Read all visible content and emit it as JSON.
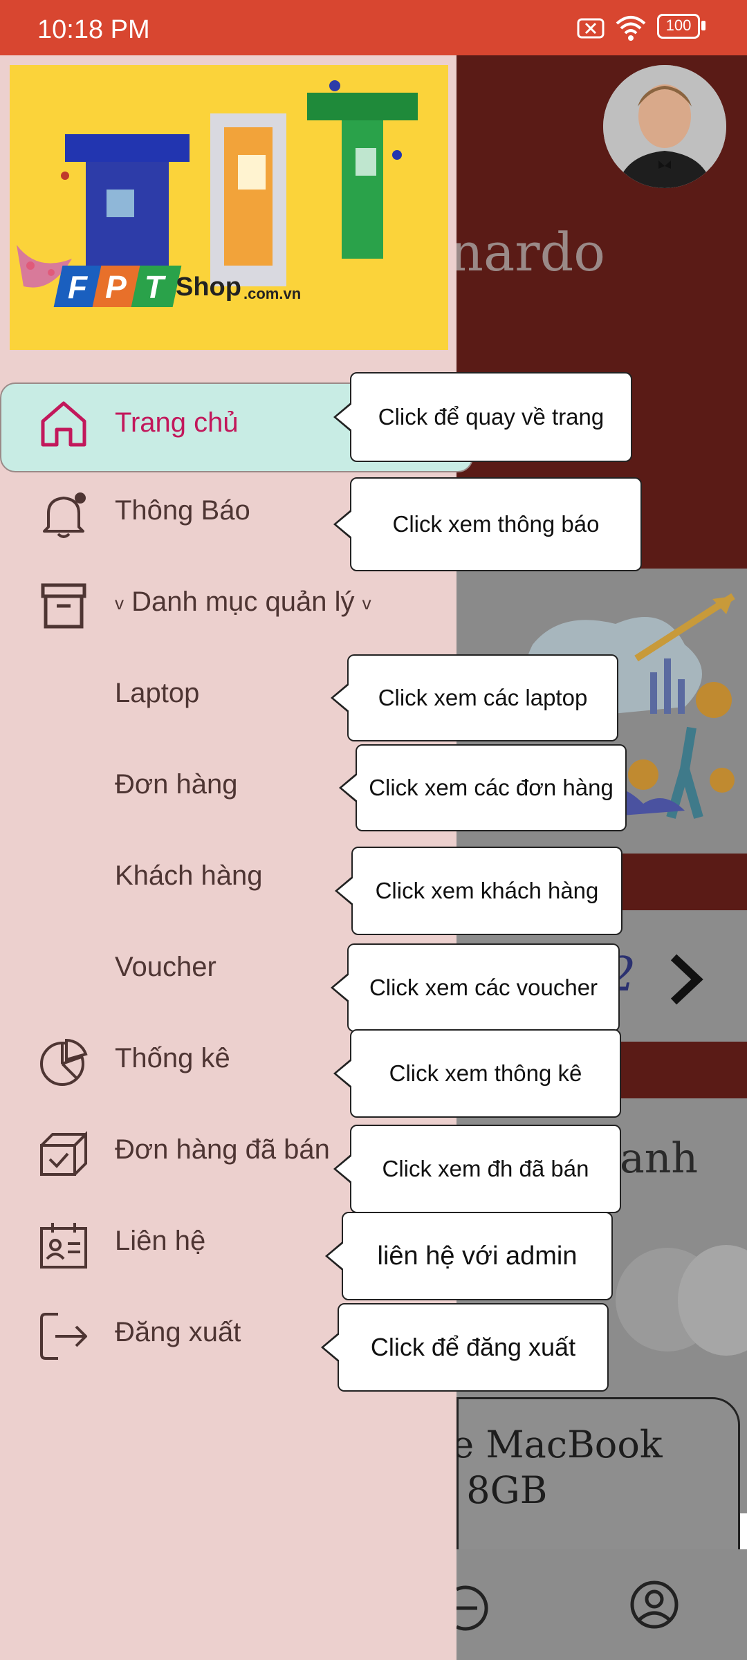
{
  "status_bar": {
    "time": "10:18 PM",
    "battery": "100"
  },
  "background_app": {
    "user_name_partial": "nardo",
    "page_fragment": "2",
    "section_title_partial": "anh",
    "card_title_partial": "le MacBook\n) 8GB"
  },
  "banner": {
    "logo_text": "FPT",
    "shop_text": "Shop",
    "shop_domain": ".com.vn"
  },
  "menu": {
    "home": "Trang chủ",
    "notifications": "Thông Báo",
    "category": "Danh mục quản lý",
    "laptop": "Laptop",
    "orders": "Đơn hàng",
    "customers": "Khách hàng",
    "voucher": "Voucher",
    "stats": "Thống kê",
    "sold_orders": "Đơn hàng đã bán",
    "contact": "Liên hệ",
    "logout": "Đăng xuất",
    "chevron": "v"
  },
  "tooltips": {
    "home": "Click để quay về trang",
    "notifications": "Click xem thông báo",
    "laptop": "Click xem các laptop",
    "orders": "Click xem các đơn hàng",
    "customers": "Click xem khách hàng",
    "voucher": "Click xem các voucher",
    "stats": "Click xem thông kê",
    "sold_orders": "Click xem đh đã bán",
    "contact": "liên hệ với admin",
    "logout": "Click để đăng xuất"
  },
  "colors": {
    "status_bar": "#d84630",
    "drawer_bg": "#ecd0ce",
    "active_bg": "#c8ece4",
    "active_text": "#c2185b",
    "menu_text": "#4e3533"
  }
}
